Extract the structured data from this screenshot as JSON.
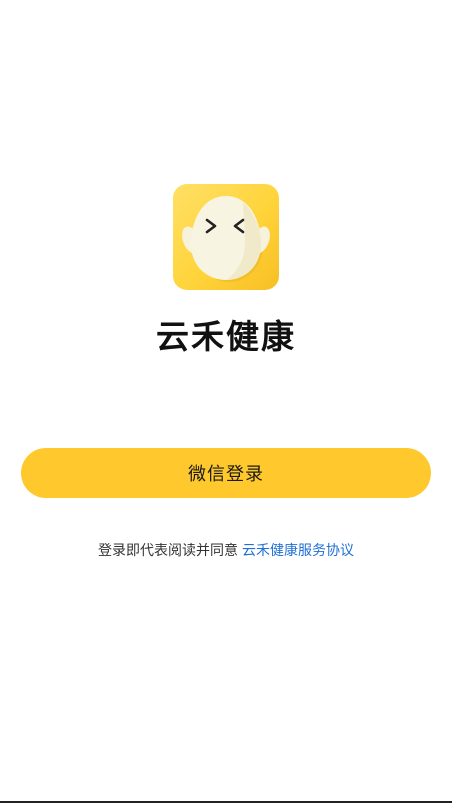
{
  "brand": {
    "logo_icon": "egg-mascot-icon",
    "name": "云禾健康",
    "accent_color": "#ffc82c"
  },
  "login": {
    "button_label": "微信登录"
  },
  "agreement": {
    "prefix": "登录即代表阅读并同意",
    "link_text": "云禾健康服务协议",
    "link_color": "#1f6fd6"
  }
}
